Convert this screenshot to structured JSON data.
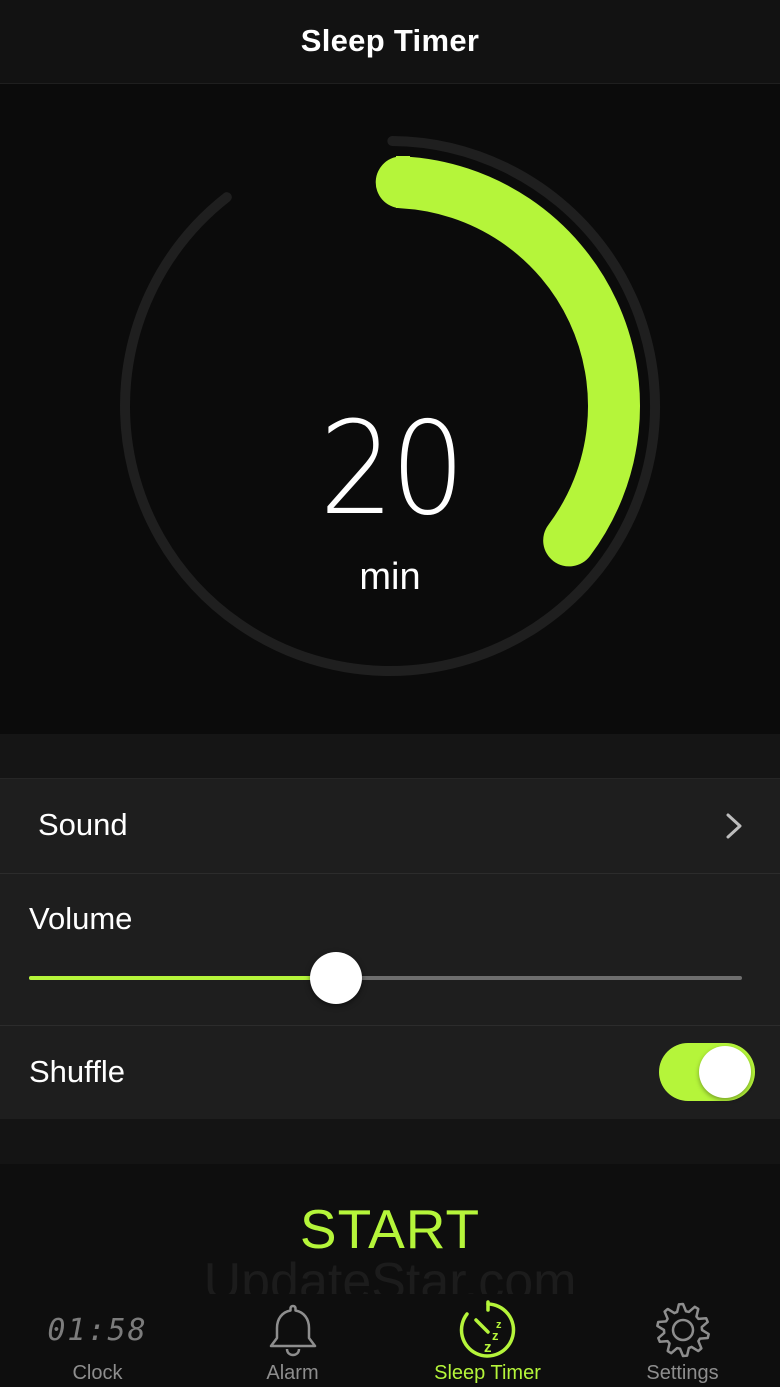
{
  "header": {
    "title": "Sleep Timer"
  },
  "dial": {
    "value": "20",
    "unit": "min",
    "fraction_of_hour": 0.333,
    "accent_color": "#b5f53a",
    "track_color": "#1f1f1f"
  },
  "settings": {
    "sound_label": "Sound",
    "volume_label": "Volume",
    "volume_level": 0.43,
    "shuffle_label": "Shuffle",
    "shuffle_on": true
  },
  "actions": {
    "start_label": "START"
  },
  "watermark": "UpdateStar.com",
  "tabbar": {
    "clock_time": "01:58",
    "items": [
      {
        "label": "Clock",
        "icon": "digital-clock-icon",
        "active": false
      },
      {
        "label": "Alarm",
        "icon": "bell-icon",
        "active": false
      },
      {
        "label": "Sleep Timer",
        "icon": "sleep-timer-icon",
        "active": true
      },
      {
        "label": "Settings",
        "icon": "gear-icon",
        "active": false
      }
    ]
  }
}
